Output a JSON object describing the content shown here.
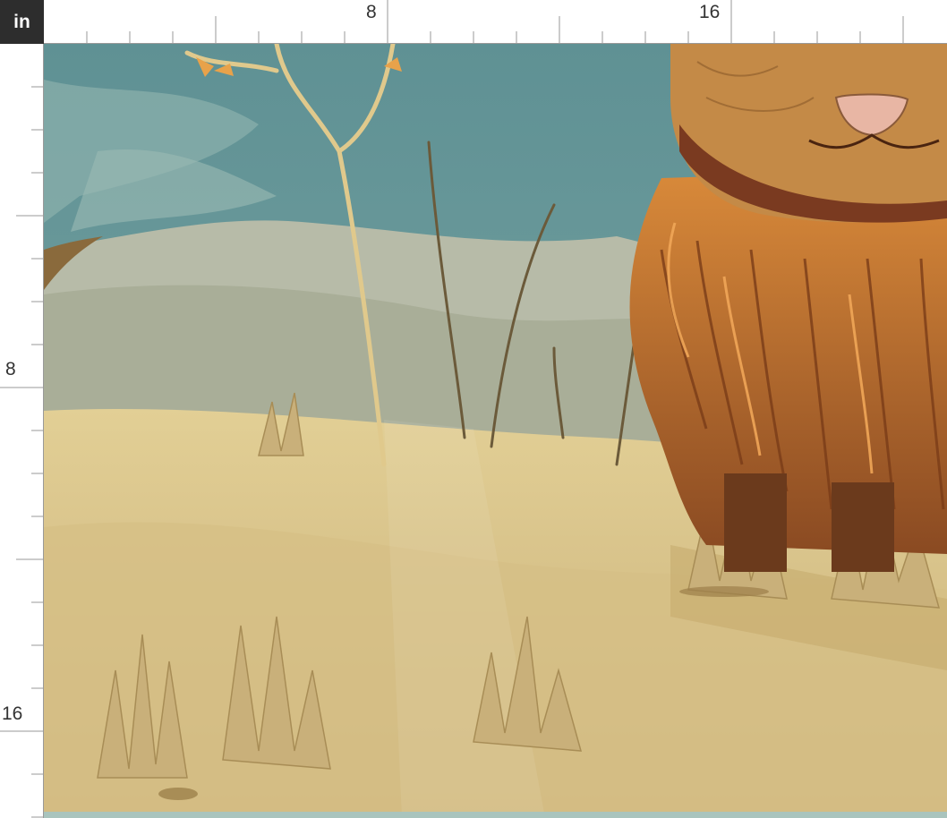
{
  "ruler": {
    "unit": "in",
    "top_labels": [
      "8",
      "16"
    ],
    "left_labels": [
      "8",
      "16"
    ]
  },
  "colors": {
    "ruler_corner": "#2d2d2d",
    "sky": "#6e9a9c",
    "hills": "#b9bca7",
    "sand": "#d9c488",
    "fur": "#c9732a",
    "face": "#c48a47"
  },
  "icons": {
    "artwork": "highland-cow-illustration"
  }
}
